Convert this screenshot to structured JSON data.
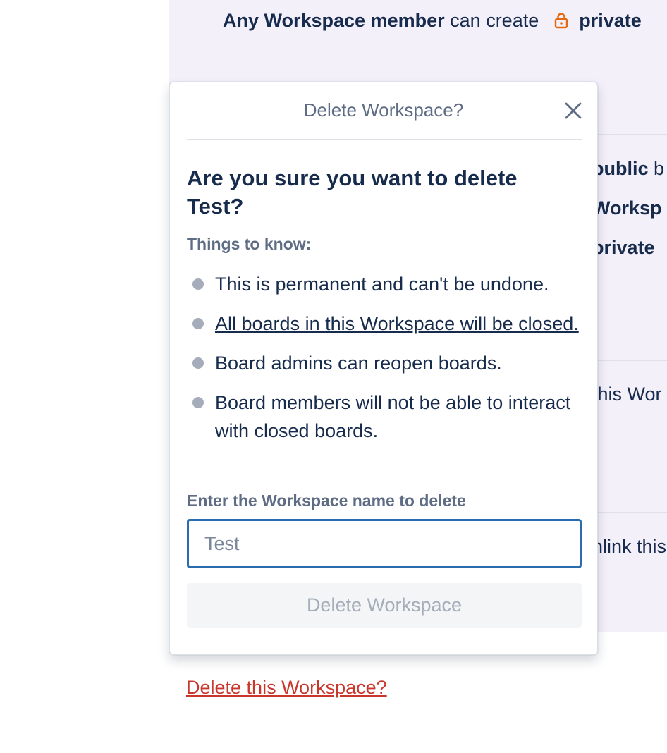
{
  "background": {
    "permission_line": {
      "subject": "Any Workspace member",
      "verb": "can create",
      "visibility": "private"
    },
    "peek_texts": {
      "public": "public",
      "public_suffix": "b",
      "workspace": "Worksp",
      "private": "private",
      "this_workspace": "this Wor",
      "unlink": "nlink this"
    },
    "delete_link": "Delete this Workspace?"
  },
  "modal": {
    "title": "Delete Workspace?",
    "question": "Are you sure you want to delete Test?",
    "things_label": "Things to know:",
    "bullets": [
      "This is permanent and can't be undone.",
      "All boards in this Workspace will be closed.",
      "Board admins can reopen boards.",
      "Board members will not be able to interact with closed boards."
    ],
    "field_label": "Enter the Workspace name to delete",
    "input_placeholder": "Test",
    "input_value": "",
    "delete_button": "Delete Workspace"
  },
  "colors": {
    "accent_danger": "#c9372c",
    "input_focus": "#2b6cb0",
    "panel_bg": "#f4f0fa",
    "text_primary": "#172b4d",
    "text_subtle": "#5e6c84"
  }
}
